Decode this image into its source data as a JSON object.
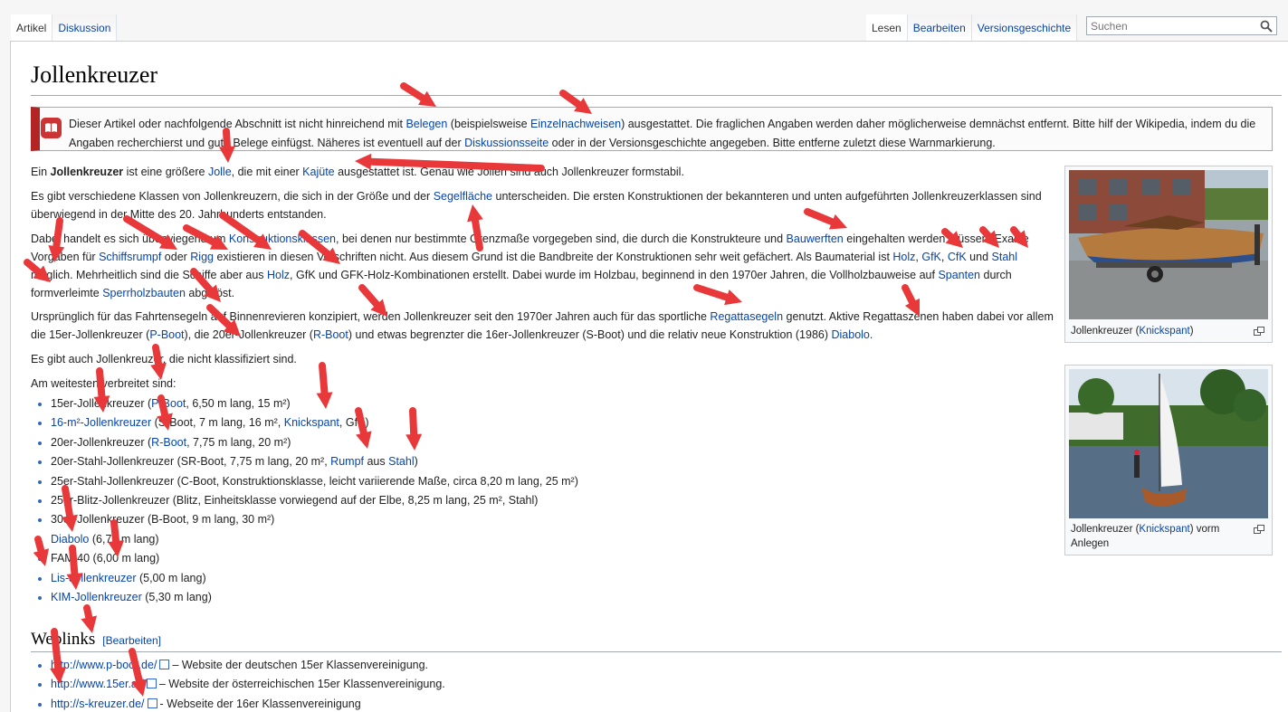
{
  "tabs_left": [
    {
      "label": "Artikel",
      "selected": true
    },
    {
      "label": "Diskussion",
      "selected": false
    }
  ],
  "tabs_right": [
    {
      "label": "Lesen",
      "selected": true
    },
    {
      "label": "Bearbeiten",
      "selected": false
    },
    {
      "label": "Versionsgeschichte",
      "selected": false
    }
  ],
  "search": {
    "placeholder": "Suchen"
  },
  "page_title": "Jollenkreuzer",
  "ambox": {
    "t1": "Dieser Artikel oder nachfolgende Abschnitt ist nicht hinreichend mit ",
    "l1": "Belegen",
    "t2": " (beispielsweise ",
    "l2": "Einzelnachweisen",
    "t3": ") ausgestattet. Die fraglichen Angaben werden daher möglicherweise demnächst entfernt. Bitte hilf der Wikipedia, indem du die Angaben recherchierst und gute Belege einfügst. Näheres ist eventuell auf der ",
    "l3": "Diskussionsseite",
    "t4": " oder in der Versionsgeschichte angegeben. Bitte entferne zuletzt diese Warnmarkierung."
  },
  "p1": {
    "t1": "Ein ",
    "b1": "Jollenkreuzer",
    "t2": " ist eine größere ",
    "l1": "Jolle",
    "t3": ", die mit einer ",
    "l2": "Kajüte",
    "t4": " ausgestattet ist. Genau wie Jollen sind auch Jollenkreuzer formstabil."
  },
  "p2": {
    "t1": "Es gibt verschiedene Klassen von Jollenkreuzern, die sich in der Größe und der ",
    "l1": "Segelfläche",
    "t2": " unterscheiden. Die ersten Konstruktionen der bekannteren und unten aufgeführten Jollenkreuzerklassen sind überwiegend in der Mitte des 20. Jahrhunderts entstanden."
  },
  "p3": {
    "t1": "Dabei handelt es sich überwiegend um ",
    "l1": "Konstruktionsklassen",
    "t2": ", bei denen nur bestimmte Grenzmaße vorgegeben sind, die durch die Konstrukteure und ",
    "l2": "Bauwerften",
    "t3": " eingehalten werden müssen. Exakte Vorgaben für ",
    "l3": "Schiffsrumpf",
    "t4": " oder ",
    "l4": "Rigg",
    "t5": " existieren in diesen Vorschriften nicht. Aus diesem Grund ist die Bandbreite der Konstruktionen sehr weit gefächert. Als Baumaterial ist ",
    "l5": "Holz",
    "t6": ", ",
    "l6": "GfK",
    "t7": ", ",
    "l7": "CfK",
    "t8": " und ",
    "l8": "Stahl",
    "t9": " möglich. Mehrheitlich sind die Schiffe aber aus ",
    "l9": "Holz",
    "t10": ", GfK und GFK-Holz-Kombinationen erstellt. Dabei wurde im Holzbau, beginnend in den 1970er Jahren, die Vollholzbauweise auf ",
    "l10": "Spanten",
    "t11": " durch formverleimte ",
    "l11": "Sperrholzbauten",
    "t12": " abgelöst."
  },
  "p4": {
    "t1": "Ursprünglich für das Fahrtensegeln auf Binnenrevieren konzipiert, werden Jollenkreuzer seit den 1970er Jahren auch für das sportliche ",
    "l1": "Regattasegeln",
    "t2": " genutzt. Aktive Regattaszenen haben dabei vor allem die 15er-Jollenkreuzer (",
    "l2": "P-Boot",
    "t3": "), die 20er-Jollenkreuzer (",
    "l3": "R-Boot",
    "t4": ") und etwas begrenzter die 16er-Jollenkreuzer (S-Boot) und die relativ neue Konstruktion (1986) ",
    "l4": "Diabolo",
    "t5": "."
  },
  "p5": "Es gibt auch Jollenkreuzer, die nicht klassifiziert sind.",
  "p6": "Am weitesten verbreitet sind:",
  "list": [
    {
      "a": "15er-Jollenkreuzer (",
      "l": "P-Boot",
      "b": ", 6,50 m lang, 15 m²)",
      "lead": false
    },
    {
      "a": "",
      "l": "16-m²-Jollenkreuzer",
      "b": " (S-Boot, 7 m lang, 16 m², ",
      "l2": "Knickspant",
      "c": ", GfK)",
      "lead": true
    },
    {
      "a": "20er-Jollenkreuzer (",
      "l": "R-Boot",
      "b": ", 7,75 m lang, 20 m²)",
      "lead": false
    },
    {
      "a": "20er-Stahl-Jollenkreuzer (SR-Boot, 7,75 m lang, 20 m², ",
      "l": "Rumpf",
      "b": " aus ",
      "l2": "Stahl",
      "c": ")",
      "lead": false
    },
    {
      "a": "25er-Stahl-Jollenkreuzer (C-Boot, Konstruktionsklasse, leicht variierende Maße, circa 8,20 m lang, 25 m²)",
      "l": "",
      "b": "",
      "lead": false
    },
    {
      "a": "25er-Blitz-Jollenkreuzer (Blitz, Einheitsklasse vorwiegend auf der Elbe, 8,25 m lang, 25 m², Stahl)",
      "l": "",
      "b": "",
      "lead": false
    },
    {
      "a": "30er-Jollenkreuzer (B-Boot, 9 m lang, 30 m²)",
      "l": "",
      "b": "",
      "lead": false
    },
    {
      "a": "",
      "l": "Diabolo",
      "b": " (6,70 m lang)",
      "lead": true
    },
    {
      "a": "FAM 40 (6,00 m lang)",
      "l": "",
      "b": "",
      "lead": false
    },
    {
      "a": "",
      "l": "Lis-Jollenkreuzer",
      "b": " (5,00 m lang)",
      "lead": true
    },
    {
      "a": "",
      "l": "KIM-Jollenkreuzer",
      "b": " (5,30 m lang)",
      "lead": true
    }
  ],
  "weblinks_heading": "Weblinks",
  "weblinks_edit": "[Bearbeiten]",
  "weblinks": [
    {
      "url": "http://www.p-boot.de/",
      "desc": "– Website der deutschen 15er Klassenvereinigung."
    },
    {
      "url": "http://www.15er.at/",
      "desc": "– Website der österreichischen 15er Klassenvereinigung."
    },
    {
      "url": "http://s-kreuzer.de/",
      "desc": "- Webseite der 16er Klassenvereinigung"
    }
  ],
  "thumb1": {
    "t1": "Jollenkreuzer (",
    "l1": "Knickspant",
    "t2": ")"
  },
  "thumb2": {
    "t1": "Jollenkreuzer (",
    "l1": "Knickspant",
    "t2": ") vorm Anlegen"
  },
  "colors": {
    "link": "#0645ad",
    "arrow": "#e8383a",
    "ambox_bar": "#b32424"
  },
  "icons": [
    "search-icon",
    "book-warning-icon",
    "external-link-icon",
    "enlarge-icon"
  ]
}
